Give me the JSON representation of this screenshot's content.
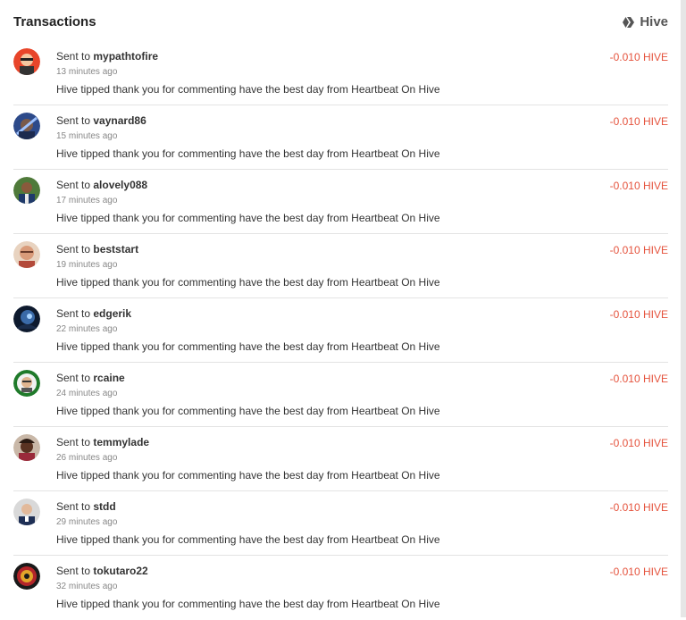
{
  "header": {
    "title": "Transactions",
    "brand_label": "Hive"
  },
  "transactions": [
    {
      "prefix": "Sent to",
      "user": "mypathtofire",
      "time": "13 minutes ago",
      "memo": "Hive tipped thank you for commenting have the best day from Heartbeat On Hive",
      "amount": "-0.010 HIVE"
    },
    {
      "prefix": "Sent to",
      "user": "vaynard86",
      "time": "15 minutes ago",
      "memo": "Hive tipped thank you for commenting have the best day from Heartbeat On Hive",
      "amount": "-0.010 HIVE"
    },
    {
      "prefix": "Sent to",
      "user": "alovely088",
      "time": "17 minutes ago",
      "memo": "Hive tipped thank you for commenting have the best day from Heartbeat On Hive",
      "amount": "-0.010 HIVE"
    },
    {
      "prefix": "Sent to",
      "user": "beststart",
      "time": "19 minutes ago",
      "memo": "Hive tipped thank you for commenting have the best day from Heartbeat On Hive",
      "amount": "-0.010 HIVE"
    },
    {
      "prefix": "Sent to",
      "user": "edgerik",
      "time": "22 minutes ago",
      "memo": "Hive tipped thank you for commenting have the best day from Heartbeat On Hive",
      "amount": "-0.010 HIVE"
    },
    {
      "prefix": "Sent to",
      "user": "rcaine",
      "time": "24 minutes ago",
      "memo": "Hive tipped thank you for commenting have the best day from Heartbeat On Hive",
      "amount": "-0.010 HIVE"
    },
    {
      "prefix": "Sent to",
      "user": "temmylade",
      "time": "26 minutes ago",
      "memo": "Hive tipped thank you for commenting have the best day from Heartbeat On Hive",
      "amount": "-0.010 HIVE"
    },
    {
      "prefix": "Sent to",
      "user": "stdd",
      "time": "29 minutes ago",
      "memo": "Hive tipped thank you for commenting have the best day from Heartbeat On Hive",
      "amount": "-0.010 HIVE"
    },
    {
      "prefix": "Sent to",
      "user": "tokutaro22",
      "time": "32 minutes ago",
      "memo": "Hive tipped thank you for commenting have the best day from Heartbeat On Hive",
      "amount": "-0.010 HIVE"
    }
  ],
  "colors": {
    "amount": "#e5533d",
    "separator": "#e3e3e3"
  }
}
